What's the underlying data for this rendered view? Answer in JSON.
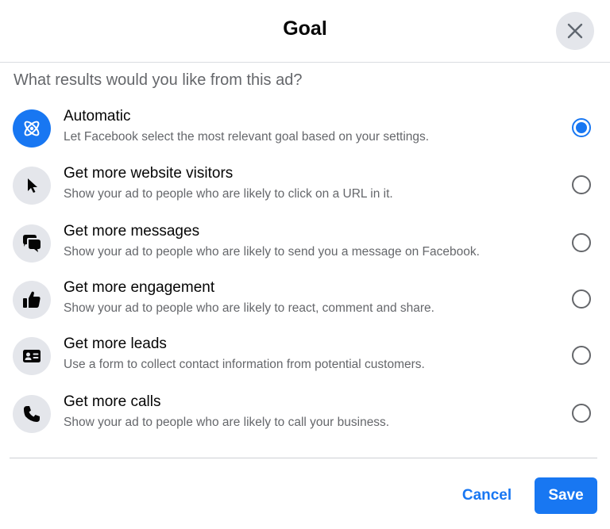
{
  "dialog": {
    "title": "Goal",
    "close_icon": "close-icon",
    "question": "What results would you like from this ad?"
  },
  "options": [
    {
      "title": "Automatic",
      "description": "Let Facebook select the most relevant goal based on your settings.",
      "icon": "atom-icon",
      "selected": true
    },
    {
      "title": "Get more website visitors",
      "description": "Show your ad to people who are likely to click on a URL in it.",
      "icon": "cursor-icon",
      "selected": false
    },
    {
      "title": "Get more messages",
      "description": "Show your ad to people who are likely to send you a message on Facebook.",
      "icon": "chat-bubbles-icon",
      "selected": false
    },
    {
      "title": "Get more engagement",
      "description": "Show your ad to people who are likely to react, comment and share.",
      "icon": "thumbs-up-icon",
      "selected": false
    },
    {
      "title": "Get more leads",
      "description": "Use a form to collect contact information from potential customers.",
      "icon": "contact-card-icon",
      "selected": false
    },
    {
      "title": "Get more calls",
      "description": "Show your ad to people who are likely to call your business.",
      "icon": "phone-icon",
      "selected": false
    }
  ],
  "footer": {
    "cancel_label": "Cancel",
    "save_label": "Save"
  },
  "colors": {
    "accent": "#1877f2",
    "icon_bg": "#e4e6eb",
    "secondary_text": "#65676b"
  }
}
